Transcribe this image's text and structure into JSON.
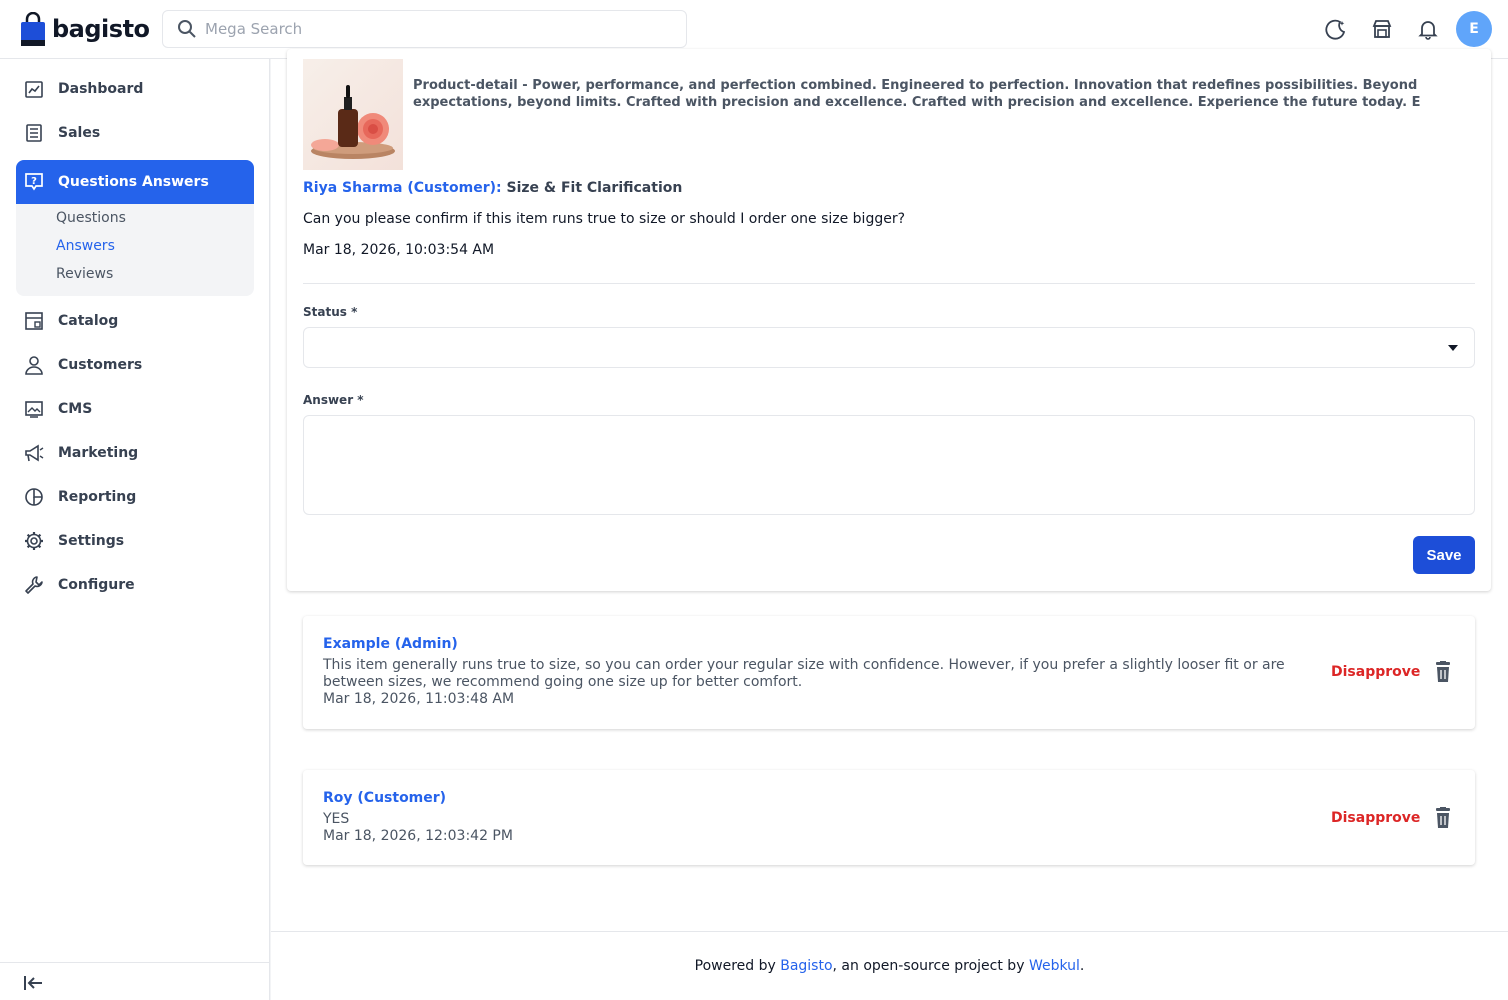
{
  "app": {
    "logo_text": "bagisto",
    "avatar_initial": "E"
  },
  "search": {
    "placeholder": "Mega Search"
  },
  "sidebar": {
    "items": [
      {
        "label": "Dashboard",
        "icon": "dashboard-icon"
      },
      {
        "label": "Sales",
        "icon": "sales-icon"
      },
      {
        "label": "Questions Answers",
        "icon": "question-icon",
        "active": true
      },
      {
        "label": "Catalog",
        "icon": "catalog-icon"
      },
      {
        "label": "Customers",
        "icon": "customers-icon"
      },
      {
        "label": "CMS",
        "icon": "cms-icon"
      },
      {
        "label": "Marketing",
        "icon": "megaphone-icon"
      },
      {
        "label": "Reporting",
        "icon": "pie-chart-icon"
      },
      {
        "label": "Settings",
        "icon": "gear-icon"
      },
      {
        "label": "Configure",
        "icon": "wrench-icon"
      }
    ],
    "submenu": [
      {
        "label": "Questions"
      },
      {
        "label": "Answers",
        "active": true
      },
      {
        "label": "Reviews"
      }
    ]
  },
  "question": {
    "product_description": "Product-detail - Power, performance, and perfection combined. Engineered to perfection. Innovation that redefines possibilities. Beyond expectations, beyond limits. Crafted with precision and excellence. Crafted with precision and excellence. Experience the future today. E",
    "author": "Riya Sharma (Customer)",
    "separator": ":",
    "title": "Size & Fit Clarification",
    "text": "Can you please confirm if this item runs true to size or should I order one size bigger?",
    "date": "Mar 18, 2026, 10:03:54 AM"
  },
  "form": {
    "status_label": "Status *",
    "status_value": "",
    "answer_label": "Answer *",
    "answer_value": "",
    "save_label": "Save"
  },
  "answers": [
    {
      "author": "Example (Admin)",
      "text": "This item generally runs true to size, so you can order your regular size with confidence. However, if you prefer a slightly looser fit or are between sizes, we recommend going one size up for better comfort.",
      "date": "Mar 18, 2026, 11:03:48 AM",
      "action": "Disapprove"
    },
    {
      "author": "Roy (Customer)",
      "text": "YES",
      "date": "Mar 18, 2026, 12:03:42 PM",
      "action": "Disapprove"
    }
  ],
  "footer": {
    "prefix": "Powered by ",
    "link1": "Bagisto",
    "middle": ", an open-source project by ",
    "link2": "Webkul",
    "suffix": "."
  },
  "colors": {
    "accent": "#2563eb",
    "danger": "#dc2626",
    "avatar": "#60a5fa"
  }
}
